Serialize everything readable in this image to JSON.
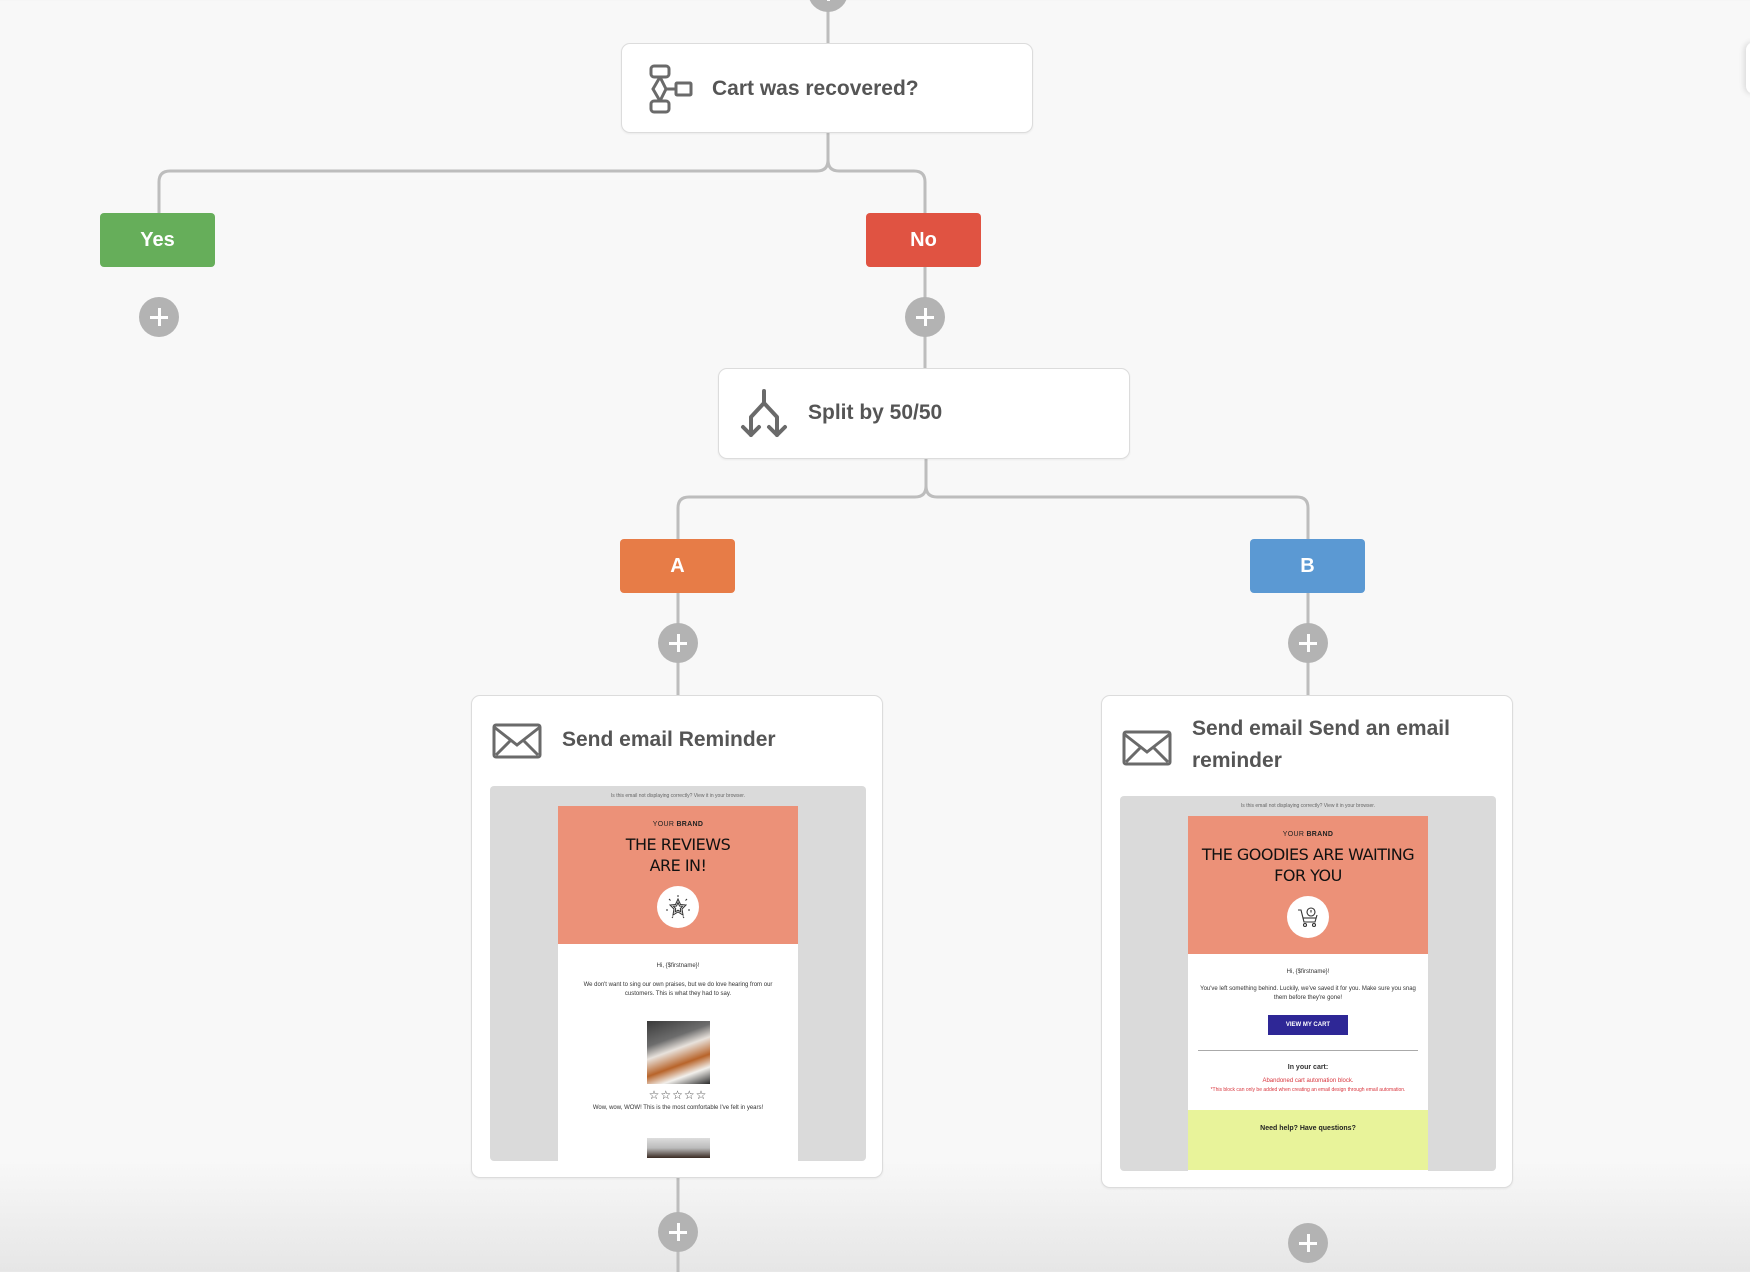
{
  "flow": {
    "condition_node": {
      "title": "Cart was recovered?",
      "icon": "condition-flow-icon"
    },
    "condition_branches": {
      "yes": {
        "label": "Yes",
        "color": "#66ae5a"
      },
      "no": {
        "label": "No",
        "color": "#e05342"
      }
    },
    "split_node": {
      "title": "Split by 50/50",
      "icon": "split-icon"
    },
    "split_branches": {
      "a": {
        "label": "A",
        "color": "#e77c47"
      },
      "b": {
        "label": "B",
        "color": "#5b99d3"
      }
    },
    "email_a": {
      "title": "Send email Reminder",
      "icon": "envelope-icon",
      "preview": {
        "browser_note": "Is this email not displaying correctly? View it in your browser.",
        "brand": "YOUR",
        "brand_bold": "BRAND",
        "headline_1": "THE REVIEWS",
        "headline_2": "ARE IN!",
        "hero_icon": "star-badge-icon",
        "greeting": "Hi, {$firstname}!",
        "intro": "We don't want to sing our own praises, but we do love hearing from our customers. This is what they had to say.",
        "rating_stars": "☆☆☆☆☆",
        "review": "Wow, wow, WOW! This is the most comfortable I've felt in years!"
      }
    },
    "email_b": {
      "title": "Send email Send an email reminder",
      "icon": "envelope-icon",
      "preview": {
        "browser_note": "Is this email not displaying correctly? View it in your browser.",
        "brand": "YOUR",
        "brand_bold": "BRAND",
        "headline_1": "THE GOODIES ARE WAITING",
        "headline_2": "FOR YOU",
        "hero_icon": "shopping-cart-icon",
        "greeting": "Hi, {$firstname}!",
        "intro": "You've left something behind. Luckily, we've saved it for you. Make sure you snag them before they're gone!",
        "cta": "VIEW MY CART",
        "cart_heading": "In your cart:",
        "cart_block": "Abandoned cart automation block.",
        "cart_note": "*This block can only be added when creating an email design through email automation.",
        "help": "Need help? Have questions?"
      }
    },
    "colors": {
      "connector": "#bdbdbd",
      "plus": "#b3b3b3",
      "node_text": "#555555",
      "hero": "#ec9178",
      "cta": "#2e2796",
      "help_bg": "#e8f39a"
    }
  }
}
